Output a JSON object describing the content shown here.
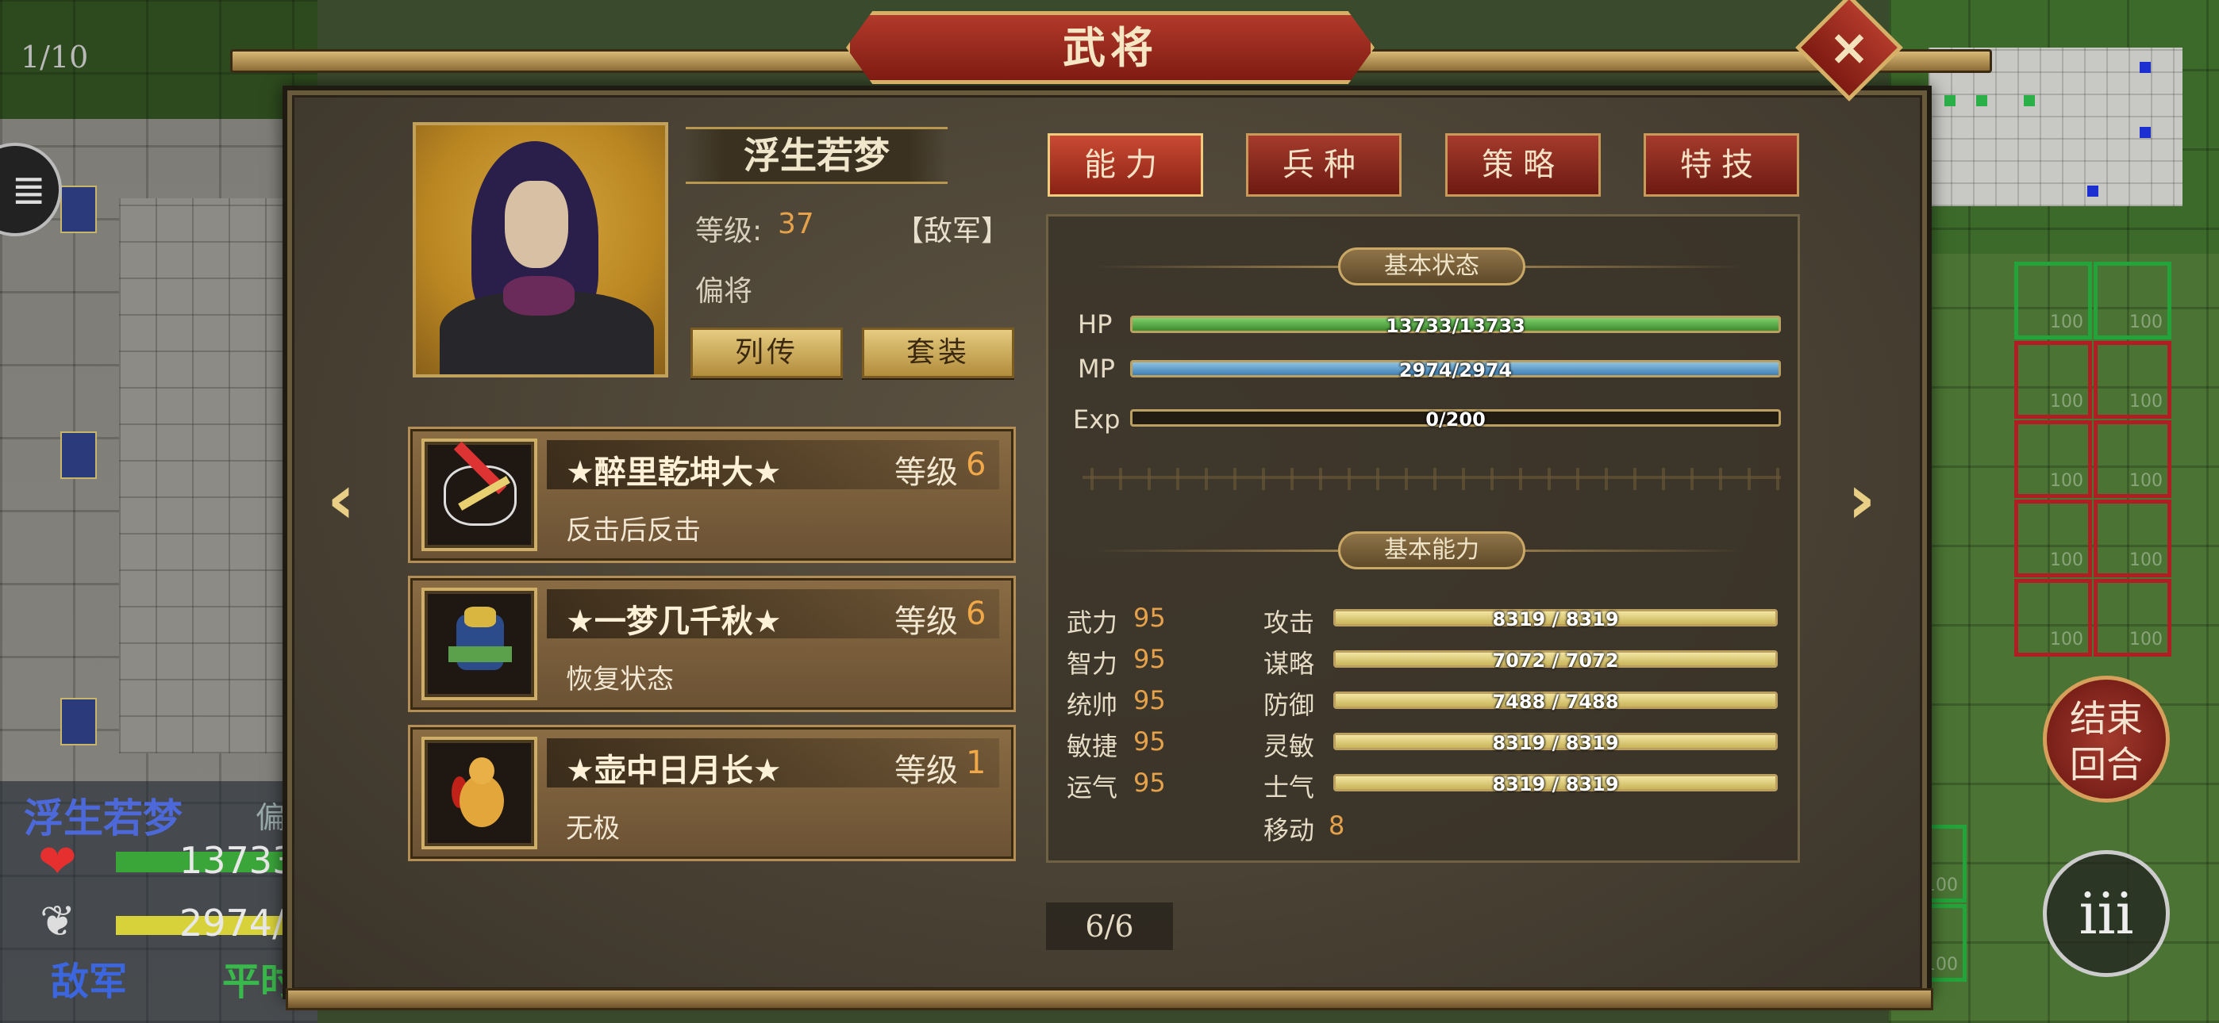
{
  "background": {
    "turn_counter": "1/10",
    "menu_icon": "scroll-menu-icon",
    "tile_number": "100",
    "unit_info": {
      "name": "浮生若梦",
      "rank_partial": "偏",
      "hp_value": "13733",
      "mp_value": "2974/",
      "faction": "敌军",
      "status_partial": "平时"
    },
    "end_turn_label_line1": "结束",
    "end_turn_label_line2": "回合",
    "settings_icon": "iii"
  },
  "dialog": {
    "title": "武将",
    "close_icon": "×",
    "general": {
      "name": "浮生若梦",
      "level_label": "等级:",
      "level_value": "37",
      "faction_tag": "【敌军】",
      "rank": "偏将",
      "biography_button": "列传",
      "equipment_button": "套装"
    },
    "skills": [
      {
        "name": "★醉里乾坤大★",
        "level_label": "等级",
        "level_value": "6",
        "description": "反击后反击",
        "icon": "sword-slash-icon"
      },
      {
        "name": "★一梦几千秋★",
        "level_label": "等级",
        "level_value": "6",
        "description": "恢复状态",
        "icon": "armor-icon"
      },
      {
        "name": "★壶中日月长★",
        "level_label": "等级",
        "level_value": "1",
        "description": "无极",
        "icon": "gourd-icon"
      }
    ],
    "tabs": [
      {
        "label": "能力",
        "active": true
      },
      {
        "label": "兵种",
        "active": false
      },
      {
        "label": "策略",
        "active": false
      },
      {
        "label": "特技",
        "active": false
      }
    ],
    "basic_status": {
      "header": "基本状态",
      "hp": {
        "label": "HP",
        "text": "13733/13733",
        "fraction": 1.0
      },
      "mp": {
        "label": "MP",
        "text": "2974/2974",
        "fraction": 1.0
      },
      "exp": {
        "label": "Exp",
        "text": "0/200",
        "fraction": 0.0
      }
    },
    "basic_ability": {
      "header": "基本能力",
      "attributes": [
        {
          "label": "武力",
          "value": "95"
        },
        {
          "label": "智力",
          "value": "95"
        },
        {
          "label": "统帅",
          "value": "95"
        },
        {
          "label": "敏捷",
          "value": "95"
        },
        {
          "label": "运气",
          "value": "95"
        }
      ],
      "combat": [
        {
          "label": "攻击",
          "text": "8319 / 8319",
          "fraction": 1.0
        },
        {
          "label": "谋略",
          "text": "7072 / 7072",
          "fraction": 1.0
        },
        {
          "label": "防御",
          "text": "7488 / 7488",
          "fraction": 1.0
        },
        {
          "label": "灵敏",
          "text": "8319 / 8319",
          "fraction": 1.0
        },
        {
          "label": "士气",
          "text": "8319 / 8319",
          "fraction": 1.0
        }
      ],
      "move_label": "移动",
      "move_value": "8"
    },
    "prev_arrow": "‹",
    "next_arrow": "›",
    "page_indicator": "6/6"
  },
  "colors": {
    "accent_gold": "#e6a24b",
    "tab_red": "#a53b2c",
    "hp_green": "#3d8c2e",
    "mp_blue": "#3f7fb4"
  }
}
